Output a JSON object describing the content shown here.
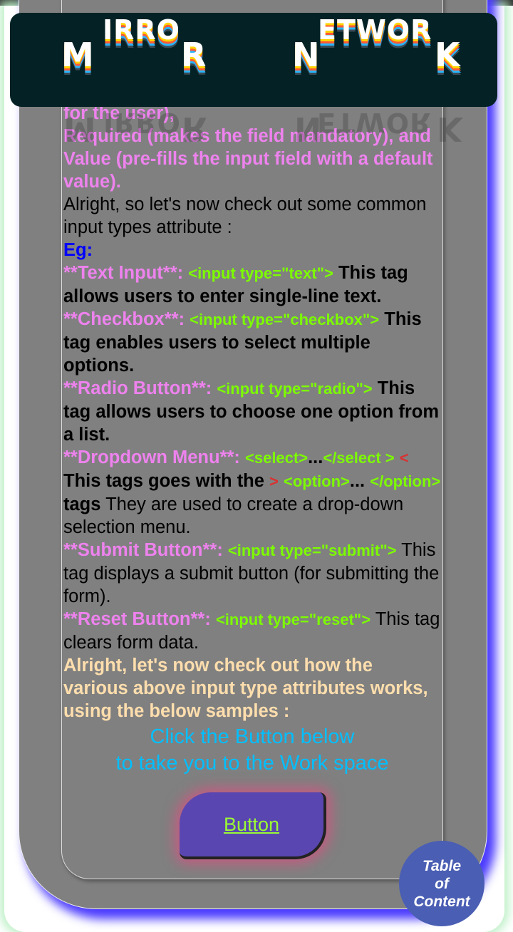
{
  "header": {
    "logo_word1": {
      "first": "M",
      "middle": "IRRO",
      "last": "R"
    },
    "logo_word2": {
      "first": "N",
      "middle": "ETWOR",
      "last": "K"
    }
  },
  "content": {
    "line1": "for the user),",
    "line2": "Required (makes the field mandatory), and Value (pre-fills the input field with a default value).",
    "line3": "Alright, so let's now check out some common input types attribute :",
    "eg_label": "Eg:",
    "items": [
      {
        "label": "**Text Input**:",
        "code": "<input type=\"text\">",
        "desc": "This tag allows users to enter single-line text."
      },
      {
        "label": "**Checkbox**:",
        "code": "<input type=\"checkbox\">",
        "desc": "This tag enables users to select multiple options."
      },
      {
        "label": "**Radio Button**:",
        "code": "<input type=\"radio\">",
        "desc": "This tag allows users to choose one option from a list."
      }
    ],
    "dropdown": {
      "label": "**Dropdown Menu**:",
      "code1": "<select>",
      "dots1": "...",
      "code2": "</select >",
      "red1": "<",
      "desc1": "This tags goes with the",
      "red2": ">",
      "code3": "<option>",
      "dots2": "...",
      "code4": "</option>",
      "tags_word": "tags",
      "desc2": "They are used to create a drop-down selection menu."
    },
    "submit": {
      "label": "**Submit Button**:",
      "code": "<input type=\"submit\">",
      "desc": "This tag displays a submit button (for submitting the form)."
    },
    "reset": {
      "label": "**Reset Button**:",
      "code": "<input type=\"reset\">",
      "desc": "This tag clears form data."
    },
    "closing": "Alright, let's now check out how the various above input type attributes works, using the below samples :",
    "cta_line1": "Click the Button below",
    "cta_line2": "to take you to the Work space"
  },
  "button": {
    "label": "Button"
  },
  "toc": {
    "line1": "Table",
    "line2": "of",
    "line3": "Content"
  },
  "colors": {
    "label_pink": "#ee82ee",
    "code_green": "#7cfc00",
    "eg_blue": "#0000ff",
    "cta_blue": "#00bfff",
    "closing_peach": "#ffdead",
    "button_bg": "#5a46b0",
    "header_bg": "#042225",
    "card_gray": "#808080"
  }
}
